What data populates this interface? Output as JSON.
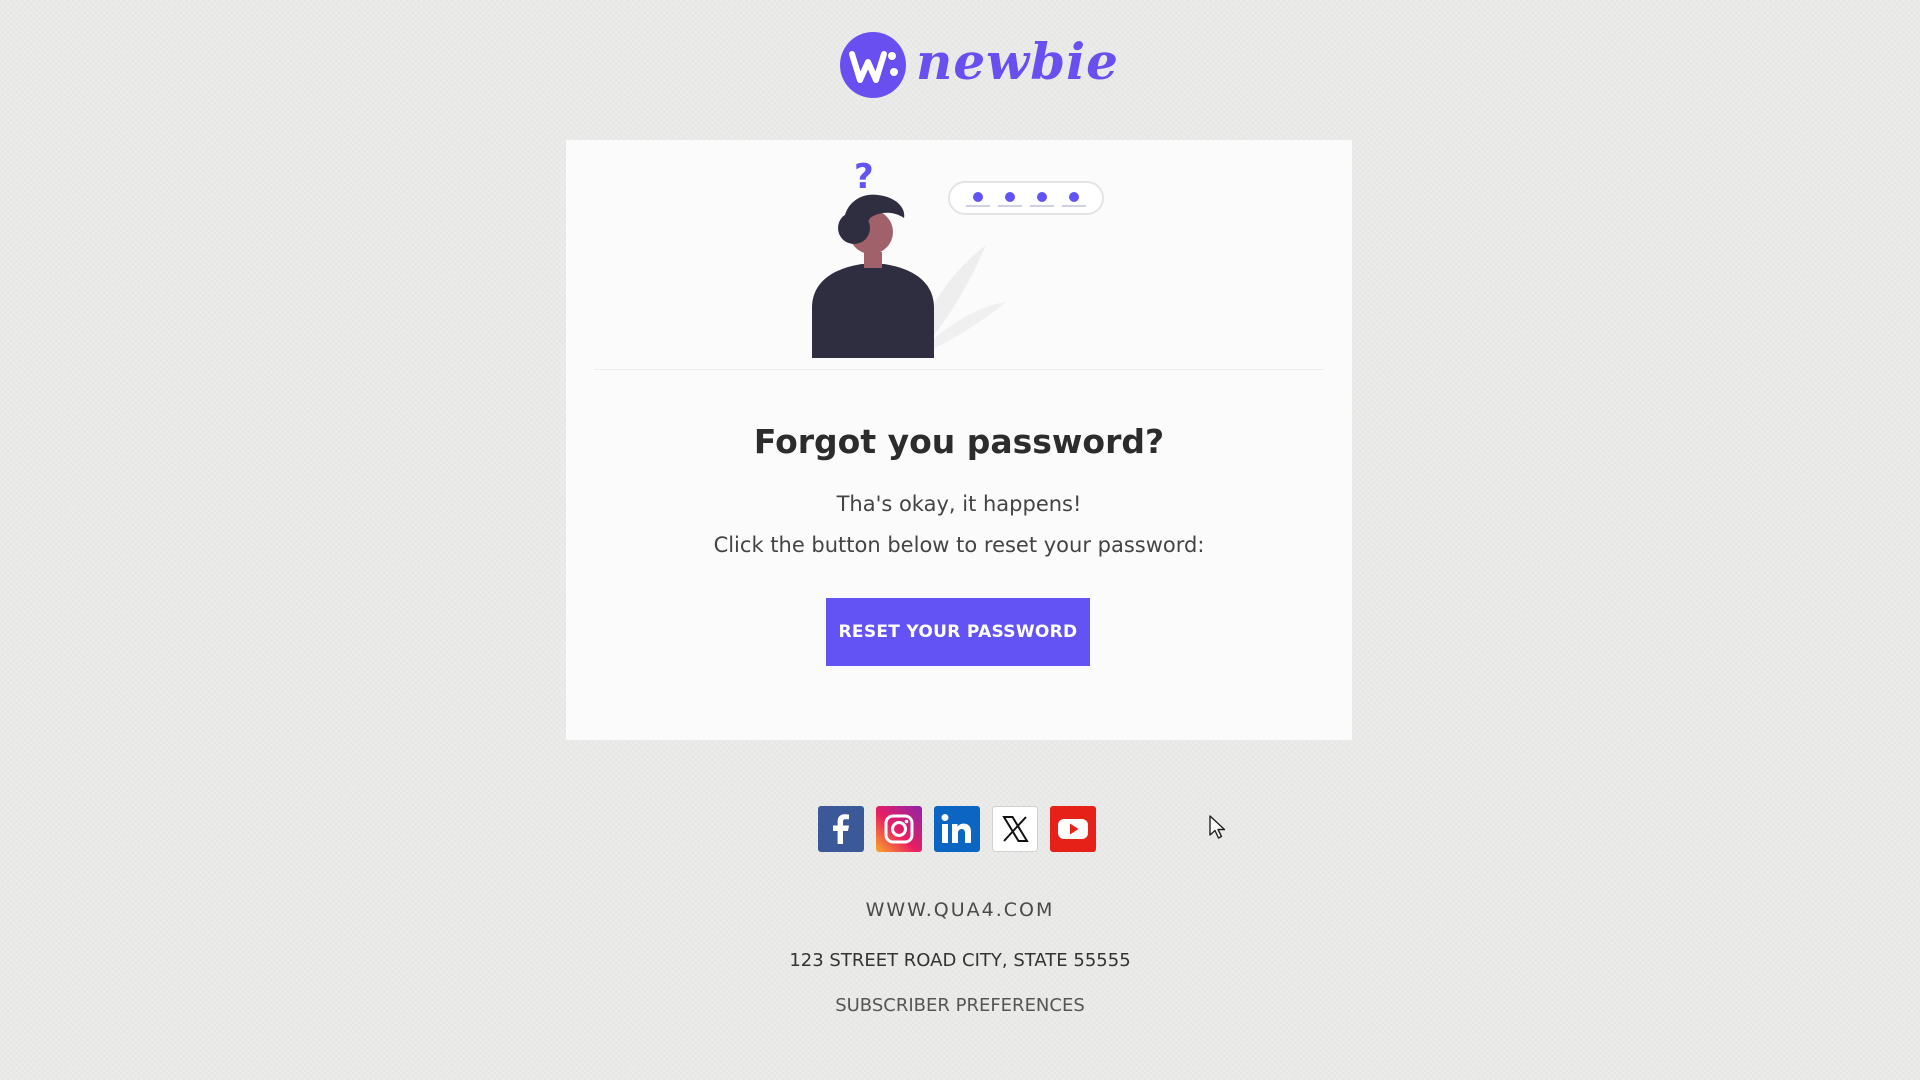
{
  "brand": {
    "logo_text": "newbie",
    "accent_color": "#6353f4"
  },
  "hero": {
    "question_mark": "?",
    "password_dots": 4
  },
  "content": {
    "headline": "Forgot you password?",
    "line1": "Tha's okay, it happens!",
    "line2": "Click the button below to reset your password:",
    "button_label": "RESET YOUR PASSWORD"
  },
  "social": [
    {
      "name": "facebook",
      "icon": "facebook-icon",
      "color": "#3b5998"
    },
    {
      "name": "instagram",
      "icon": "instagram-icon",
      "color": "#e1306c"
    },
    {
      "name": "linkedin",
      "icon": "linkedin-icon",
      "color": "#0a66c2"
    },
    {
      "name": "x",
      "icon": "x-icon",
      "color": "#000000"
    },
    {
      "name": "youtube",
      "icon": "youtube-icon",
      "color": "#e62117"
    }
  ],
  "footer": {
    "website": "WWW.QUA4.COM",
    "address": "123 STREET ROAD CITY, STATE 55555",
    "preferences": "SUBSCRIBER PREFERENCES"
  }
}
